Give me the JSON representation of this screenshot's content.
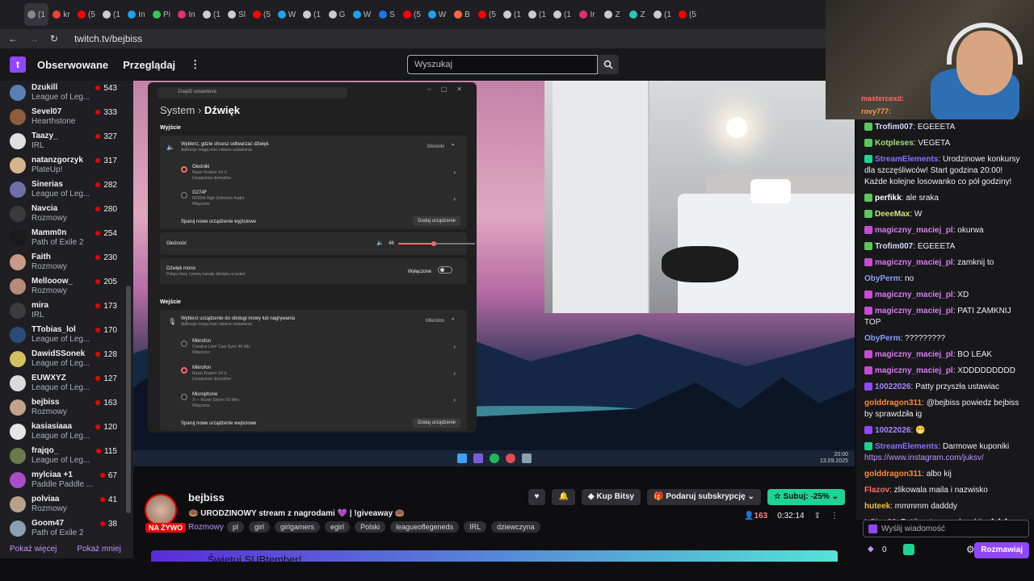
{
  "browser": {
    "tabs": [
      "(1",
      "kr",
      "(5",
      "(1",
      "In",
      "Pi",
      "In",
      "(1",
      "Sl",
      "(5",
      "W",
      "(1",
      "G",
      "W",
      "S",
      "(5",
      "W",
      "B",
      "(5",
      "(1",
      "(1",
      "(1",
      "Ir",
      "Z",
      "Z",
      "(1",
      "(5"
    ],
    "url": "twitch.tv/bejbiss"
  },
  "nav": {
    "logo": "t",
    "followed": "Obserwowane",
    "browse": "Przeglądaj",
    "more": "⋮",
    "search_placeholder": "Wyszukaj"
  },
  "sidebar": {
    "channels": [
      {
        "name": "Dzukill",
        "game": "League of Leg...",
        "viewers": "543",
        "color": "#5a7fb5"
      },
      {
        "name": "Sevel07",
        "game": "Hearthstone",
        "viewers": "333",
        "color": "#8c5c3c"
      },
      {
        "name": "Taazy_",
        "game": "IRL",
        "viewers": "327",
        "color": "#e0e0e0"
      },
      {
        "name": "natanzgorzyk",
        "game": "PlateUp!",
        "viewers": "317",
        "color": "#d7b58a"
      },
      {
        "name": "Sinerias",
        "game": "League of Leg...",
        "viewers": "282",
        "color": "#6f6fa8"
      },
      {
        "name": "Navcia",
        "game": "Rozmowy",
        "viewers": "280",
        "color": "#3a3a3a"
      },
      {
        "name": "Mamm0n",
        "game": "Path of Exile 2",
        "viewers": "254",
        "color": "#1a1a1a"
      },
      {
        "name": "Faith",
        "game": "Rozmowy",
        "viewers": "230",
        "color": "#c79a8a"
      },
      {
        "name": "Mellooow_",
        "game": "Rozmowy",
        "viewers": "205",
        "color": "#b88a7a"
      },
      {
        "name": "mira",
        "game": "IRL",
        "viewers": "173",
        "color": "#3c3c3c"
      },
      {
        "name": "TTobias_lol",
        "game": "League of Leg...",
        "viewers": "170",
        "color": "#2b4c7a"
      },
      {
        "name": "DawidSSonek",
        "game": "League of Leg...",
        "viewers": "128",
        "color": "#d4c060"
      },
      {
        "name": "EUWXYZ",
        "game": "League of Leg...",
        "viewers": "127",
        "color": "#dadada"
      },
      {
        "name": "bejbiss",
        "game": "Rozmowy",
        "viewers": "163",
        "color": "#c3a38c"
      },
      {
        "name": "kasiasiaaa",
        "game": "League of Leg...",
        "viewers": "120",
        "color": "#e5e5e5"
      },
      {
        "name": "frajqo_",
        "game": "League of Leg...",
        "viewers": "115",
        "color": "#6a7a4c"
      },
      {
        "name": "mylciaa +1",
        "game": "Paddle Paddle ...",
        "viewers": "67",
        "color": "#a94cc8"
      },
      {
        "name": "polviaa",
        "game": "Rozmowy",
        "viewers": "41",
        "color": "#b9a08a"
      },
      {
        "name": "Goom47",
        "game": "Path of Exile 2",
        "viewers": "38",
        "color": "#8aa0b5"
      }
    ],
    "show_more": "Pokaż więcej",
    "show_less": "Pokaż mniej"
  },
  "settings": {
    "search_placeholder": "Znajdź ustawienie",
    "window_buttons": "–▢✕",
    "crumb": "System",
    "title": "Dźwięk",
    "output_section": "Wyjście",
    "output_title": "Wybierz, gdzie chcesz odtwarzać dźwięk",
    "output_sub": "Aplikacje mogą mieć własne ustawienia",
    "output_value": "Głośniki",
    "dev1_name": "Głośniki",
    "dev1_a": "Razer Kraken V4 X",
    "dev1_b": "Urządzenie domyślne",
    "dev2_name": "G274F",
    "dev2_a": "NVIDIA High Definition Audio",
    "dev2_b": "Włączone",
    "pair_output": "Sparuj nowe urządzenie wyjściowe",
    "add_device": "Dodaj urządzenie",
    "volume_label": "Głośność",
    "volume_value": "46",
    "volume_level": 0.46,
    "mono_title": "Dźwięk mono",
    "mono_sub": "Połącz lewy i prawy kanały dźwięku w jeden",
    "mono_state": "Wyłączone",
    "input_section": "Wejście",
    "input_title": "Wybierz urządzenie do obsługi mowy lub nagrywania",
    "input_sub": "Aplikacje mogą mieć własne ustawienia",
    "input_value": "Mikrofon",
    "in1_name": "Mikrofon",
    "in1_a": "Creative Live! Cam Sync 4K Mic",
    "in1_b": "Włączone",
    "in2_name": "Mikrofon",
    "in2_a": "Razer Kraken V4 X",
    "in2_b": "Urządzenie domyślne",
    "in3_name": "Microphone",
    "in3_a": "3 — Razer Seiren V3 Mini",
    "in3_b": "Włączone",
    "pair_input": "Sparuj nowe urządzenie wejściowe",
    "add_device2": "Dodaj urządzenie"
  },
  "taskbar": {
    "time": "20:00",
    "date": "13.09.2025"
  },
  "webcam_overlay": {
    "line1": "mastercexd:",
    "line2": "rovy777:"
  },
  "chat": {
    "messages": [
      {
        "user": "Trofim007",
        "color": "#d8d8ff",
        "text": "EGEEETA",
        "badge": "#5cc75c"
      },
      {
        "user": "Kotpleses",
        "color": "#9ae27a",
        "text": "VEGETA",
        "badge": "#5cc75c"
      },
      {
        "user": "StreamElements",
        "color": "#8a6fff",
        "text": "Urodzinowe konkursy dla szczęśliwców! Start godzina 20:00! Każde kolejne losowanko co pół godziny!",
        "badge": "#1fd395"
      },
      {
        "user": "perfikk",
        "color": "#ffffff",
        "text": "ale sraka",
        "badge": "#5cc75c"
      },
      {
        "user": "DeeeMax",
        "color": "#d4e17a",
        "text": "W",
        "badge": "#5cc75c"
      },
      {
        "user": "magiczny_maciej_pl",
        "color": "#d97cf0",
        "text": "okurwa",
        "badge": "#c84bd8"
      },
      {
        "user": "Trofim007",
        "color": "#d8d8ff",
        "text": "EGEEETA",
        "badge": "#5cc75c"
      },
      {
        "user": "magiczny_maciej_pl",
        "color": "#d97cf0",
        "text": "zamknij to",
        "badge": "#c84bd8"
      },
      {
        "user": "ObyPerm",
        "color": "#8a9dff",
        "text": "no",
        "badge": ""
      },
      {
        "user": "magiczny_maciej_pl",
        "color": "#d97cf0",
        "text": "XD",
        "badge": "#c84bd8"
      },
      {
        "user": "magiczny_maciej_pl",
        "color": "#d97cf0",
        "text": "PATI ZAMKNIJ TOP",
        "badge": "#c84bd8"
      },
      {
        "user": "ObyPerm",
        "color": "#8a9dff",
        "text": "?????????",
        "badge": ""
      },
      {
        "user": "magiczny_maciej_pl",
        "color": "#d97cf0",
        "text": "BO LEAK",
        "badge": "#c84bd8"
      },
      {
        "user": "magiczny_maciej_pl",
        "color": "#d97cf0",
        "text": "XDDDDDDDDD",
        "badge": "#c84bd8"
      },
      {
        "user": "10022026",
        "color": "#a08aff",
        "text": "Patty przyszła ustawiac",
        "badge": "#9146ff"
      },
      {
        "user": "golddragon311",
        "color": "#ff8a3c",
        "text": "@bejbiss powiedz bejbiss by sprawdziła ig",
        "badge": ""
      },
      {
        "user": "10022026",
        "color": "#a08aff",
        "text": "😁",
        "badge": "#9146ff"
      },
      {
        "user": "StreamElements",
        "color": "#8a6fff",
        "text": "Darmowe kuponiki",
        "link": "https://www.instagram.com/juksv/",
        "badge": "#1fd395"
      },
      {
        "user": "golddragon311",
        "color": "#ff8a3c",
        "text": "albo kij",
        "badge": ""
      },
      {
        "user": "Flazov",
        "color": "#ff6a6a",
        "text": "zlikowala maila i nazwisko",
        "badge": ""
      },
      {
        "user": "huteek",
        "color": "#f0c040",
        "text": "mmmmm dadddy",
        "badge": ""
      },
      {
        "user": "IrCio_36",
        "color": "#d97cf0",
        "text": "Pattka stres ma bez kitu ✚✚✚",
        "badge": ""
      }
    ],
    "input_placeholder": "Wyślij wiadomość",
    "points": "0",
    "chat_button": "Rozmawiaj"
  },
  "stream": {
    "name": "bejbiss",
    "live": "NA ŻYWO",
    "title": "🍩 URODZINOWY stream z nagrodami 💜 | !giveaway 🍩",
    "category": "Rozmowy",
    "tags": [
      "pl",
      "girl",
      "girlgamers",
      "egirl",
      "Polski",
      "leagueoflegeneds",
      "IRL",
      "dziewczyna"
    ],
    "bits": "Kup Bitsy",
    "gift": "Podaruj subskrypcję",
    "subscribe": "Subuj: -25%",
    "viewers": "163",
    "uptime": "0:32:14",
    "banner": "Świętuj SUBtember!"
  },
  "colors": {
    "accent": "#9146ff",
    "live": "#eb0400",
    "sub": "#1fd395"
  }
}
